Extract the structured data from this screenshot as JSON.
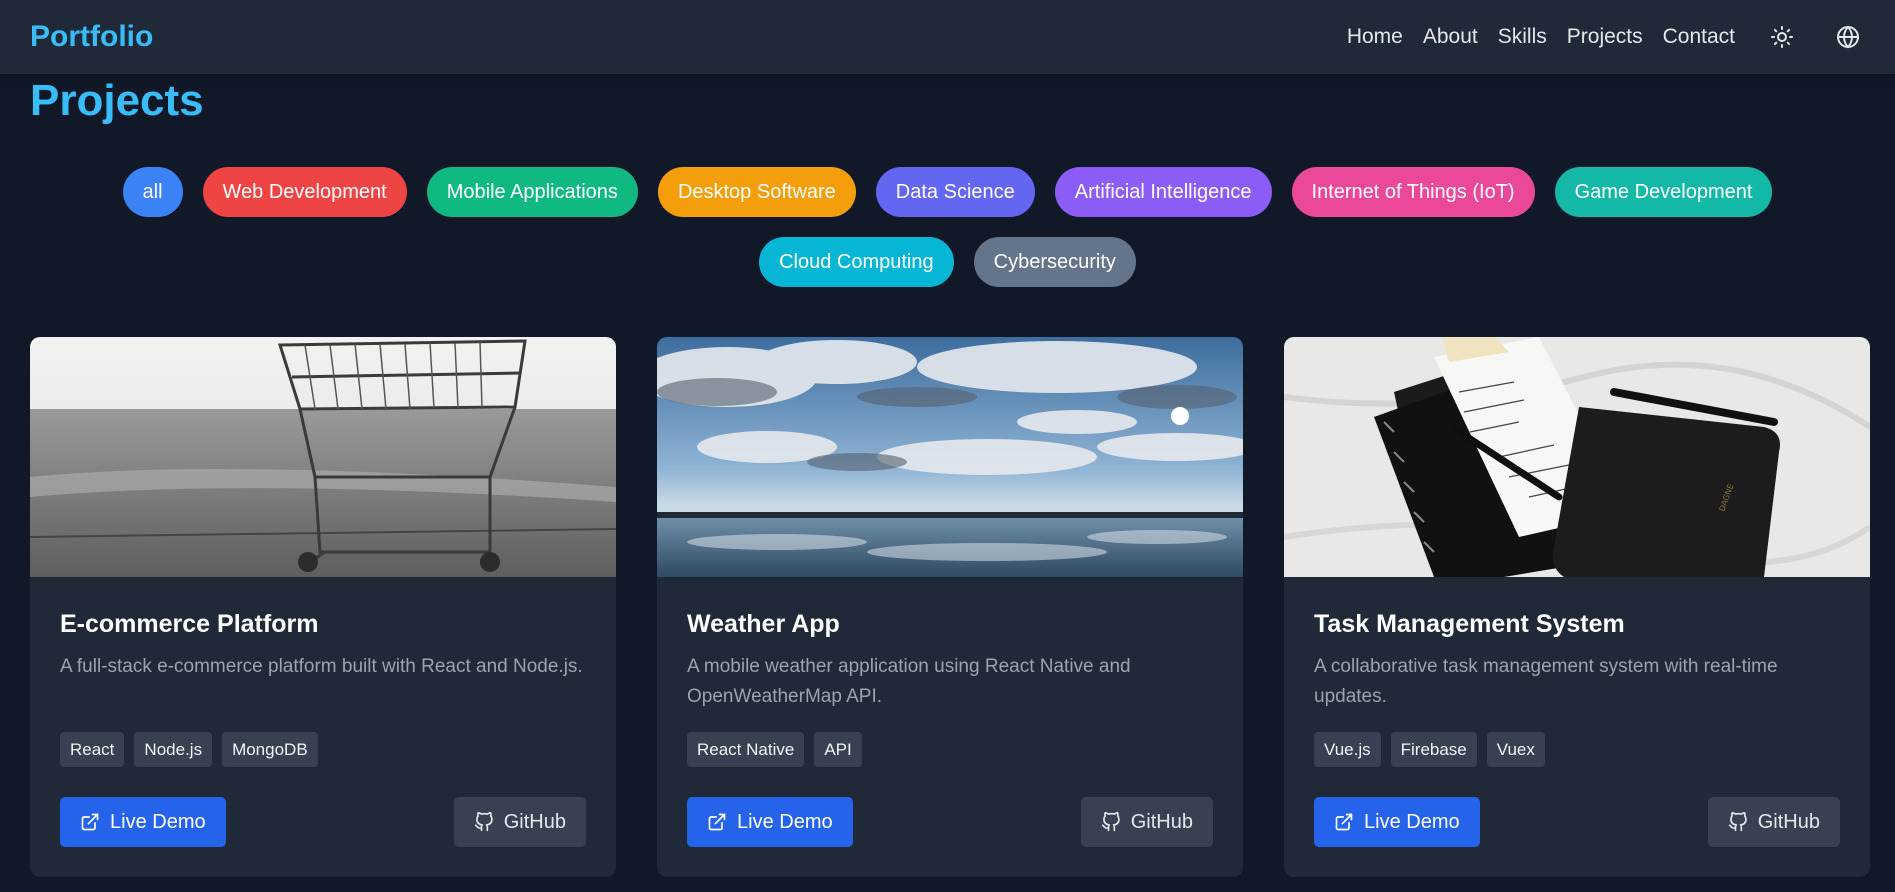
{
  "nav": {
    "logo": "Portfolio",
    "links": [
      "Home",
      "About",
      "Skills",
      "Projects",
      "Contact"
    ]
  },
  "section": {
    "title": "Projects"
  },
  "filters": [
    {
      "label": "all",
      "color": "#3b82f6"
    },
    {
      "label": "Web Development",
      "color": "#ef4444"
    },
    {
      "label": "Mobile Applications",
      "color": "#10b981"
    },
    {
      "label": "Desktop Software",
      "color": "#f59e0b"
    },
    {
      "label": "Data Science",
      "color": "#6366f1"
    },
    {
      "label": "Artificial Intelligence",
      "color": "#8b5cf6"
    },
    {
      "label": "Internet of Things (IoT)",
      "color": "#ec4899"
    },
    {
      "label": "Game Development",
      "color": "#14b8a6"
    },
    {
      "label": "Cloud Computing",
      "color": "#06b6d4"
    },
    {
      "label": "Cybersecurity",
      "color": "#64748b"
    }
  ],
  "projects": [
    {
      "title": "E-commerce Platform",
      "description": "A full-stack e-commerce platform built with React and Node.js.",
      "tags": [
        "React",
        "Node.js",
        "MongoDB"
      ],
      "demo_label": "Live Demo",
      "github_label": "GitHub"
    },
    {
      "title": "Weather App",
      "description": "A mobile weather application using React Native and OpenWeatherMap API.",
      "tags": [
        "React Native",
        "API"
      ],
      "demo_label": "Live Demo",
      "github_label": "GitHub"
    },
    {
      "title": "Task Management System",
      "description": "A collaborative task management system with real-time updates.",
      "tags": [
        "Vue.js",
        "Firebase",
        "Vuex"
      ],
      "demo_label": "Live Demo",
      "github_label": "GitHub"
    }
  ],
  "icons": {
    "theme": "sun-icon",
    "language": "globe-icon",
    "demo": "external-link-icon",
    "github": "github-icon"
  },
  "colors": {
    "accent": "#38bdf8",
    "primary_button": "#2563eb",
    "secondary_button": "#374151",
    "card_bg": "#1f2937",
    "page_bg": "#111827"
  }
}
